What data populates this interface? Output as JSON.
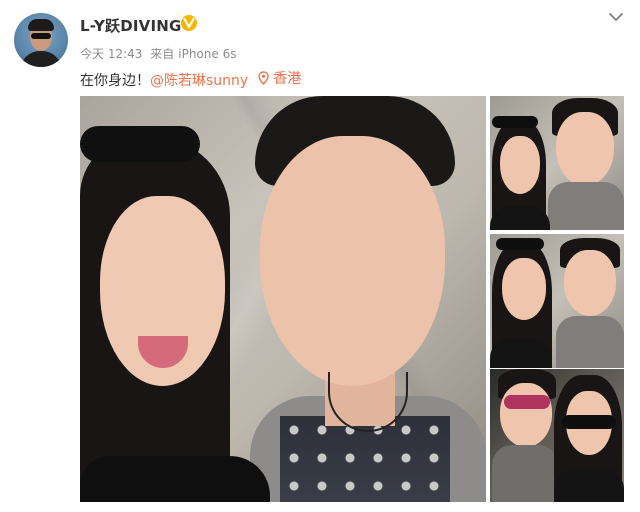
{
  "post": {
    "username": "L-Y跃DIVING",
    "verified": true,
    "time": "今天 12:43",
    "source_prefix": "来自",
    "source_device": "iPhone 6s",
    "text_before": "在你身边！",
    "mention": "@陈若琳sunny",
    "location": "香港"
  },
  "icons": {
    "verified": "verified-badge-icon",
    "menu": "chevron-down-icon",
    "location": "location-pin-icon"
  },
  "colors": {
    "accent": "#eb7350",
    "verified": "#f5b400",
    "meta_text": "#8c8c8c"
  }
}
